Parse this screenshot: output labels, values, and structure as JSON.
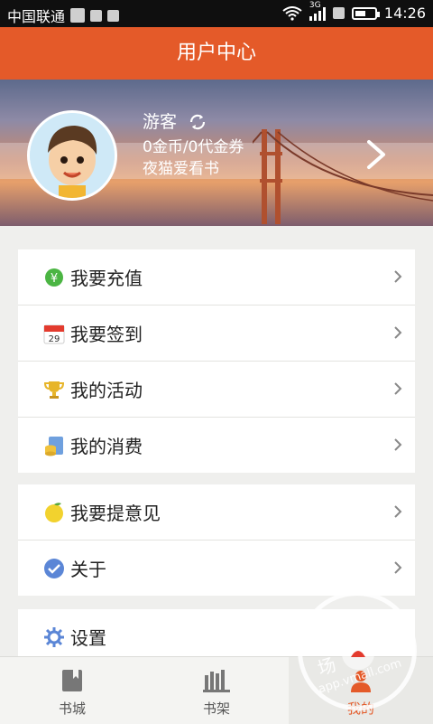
{
  "status_bar": {
    "carrier": "中国联通",
    "network": "3G",
    "time": "14:26",
    "battery_level": 0.55
  },
  "header": {
    "title": "用户中心"
  },
  "profile": {
    "name": "游客",
    "coins": "0金币/0代金券",
    "slogan": "夜猫爱看书"
  },
  "menu_groups": [
    {
      "items": [
        {
          "label": "我要充值",
          "icon": "yuan-coin-icon"
        },
        {
          "label": "我要签到",
          "icon": "calendar-icon",
          "icon_text": "29"
        },
        {
          "label": "我的活动",
          "icon": "trophy-icon"
        },
        {
          "label": "我的消费",
          "icon": "wallet-coins-icon"
        }
      ]
    },
    {
      "items": [
        {
          "label": "我要提意见",
          "icon": "lemon-icon"
        },
        {
          "label": "关于",
          "icon": "check-circle-icon"
        }
      ]
    },
    {
      "items": [
        {
          "label": "设置",
          "icon": "gear-icon"
        }
      ]
    }
  ],
  "tabbar": {
    "tabs": [
      {
        "label": "书城",
        "icon": "bookmark-book-icon"
      },
      {
        "label": "书架",
        "icon": "bookshelf-icon"
      },
      {
        "label": "我的",
        "icon": "user-icon"
      }
    ],
    "active_index": 2
  },
  "watermark": {
    "top_text": "华为应用市场",
    "bottom_text": "app.vmall.com"
  },
  "colors": {
    "accent": "#e45a29",
    "green": "#4bb543",
    "blue": "#5b86d6",
    "gold": "#e7b52a"
  },
  "icons": {
    "wifi": "wifi-icon",
    "signal": "signal-icon",
    "battery": "battery-icon",
    "refresh": "refresh-icon",
    "chevron": "chevron-right-icon"
  },
  "icon_text": {
    "yuan": "¥"
  }
}
